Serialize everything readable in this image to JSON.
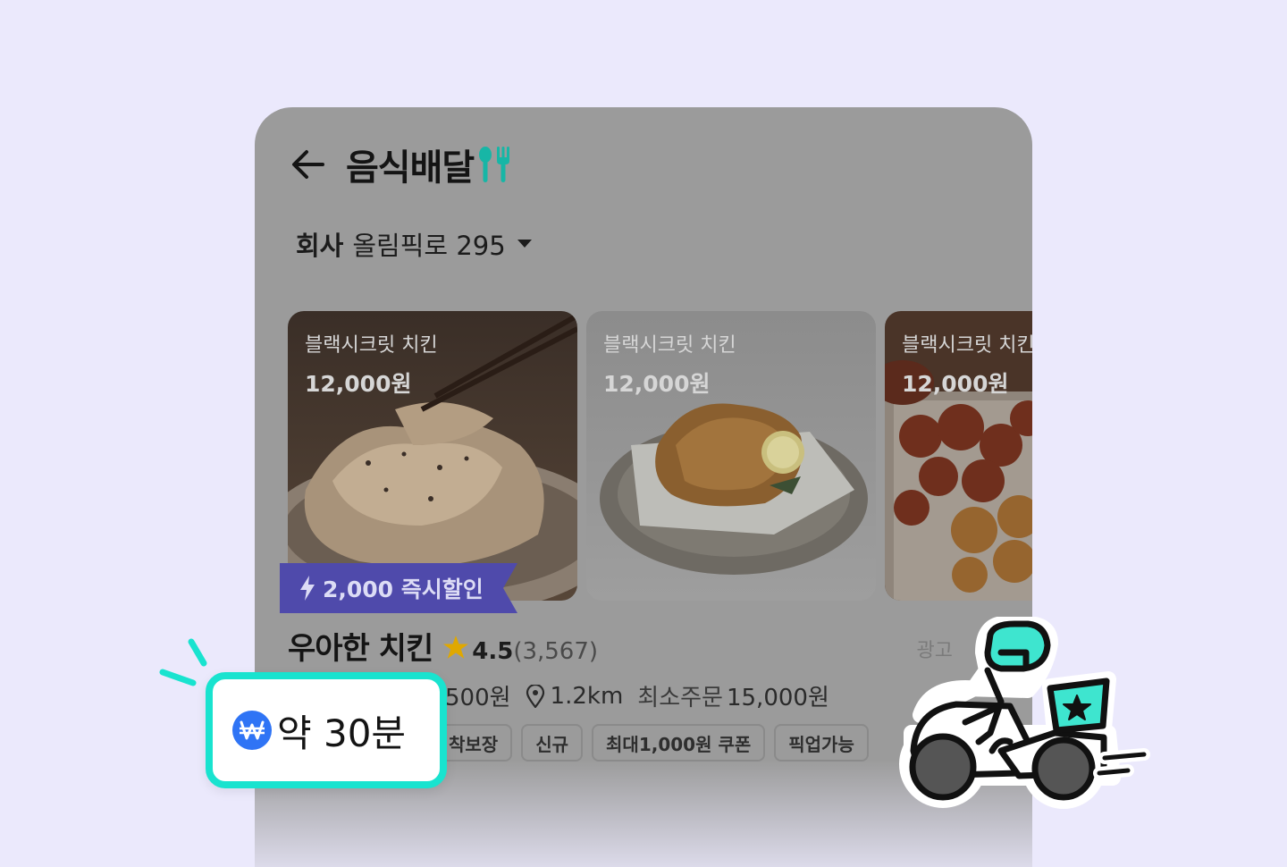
{
  "header": {
    "title": "음식배달"
  },
  "address": {
    "label": "회사",
    "value": "올림픽로 295"
  },
  "cards": [
    {
      "name": "블랙시크릿 치킨",
      "price": "12,000원"
    },
    {
      "name": "블랙시크릿 치킨",
      "price": "12,000원"
    },
    {
      "name": "블랙시크릿 치킨",
      "price": "12,000원"
    }
  ],
  "discount": {
    "label": "2,000 즉시할인"
  },
  "store": {
    "name": "우아한 치킨",
    "rating": "4.5",
    "reviews": "(3,567)",
    "ad_label": "광고"
  },
  "info": {
    "delivery_fee": "500원",
    "distance": "1.2km",
    "min_order_label": "최소주문",
    "min_order_value": "15,000원"
  },
  "tags": [
    "착보장",
    "신규",
    "최대1,000원 쿠폰",
    "픽업가능"
  ],
  "eta": {
    "text": "약 30분"
  },
  "colors": {
    "background": "#ebe9fc",
    "accent_mint": "#19e3cf",
    "discount_purple": "#4f4aab",
    "won_blue": "#2f74f5",
    "star": "#e0a800"
  },
  "icons": {
    "back": "arrow-left-icon",
    "utensils": "fork-spoon-icon",
    "caret": "caret-down-icon",
    "bolt": "lightning-icon",
    "star": "star-icon",
    "pin": "location-pin-icon",
    "won": "won-coin-icon",
    "rider": "delivery-rider-icon"
  }
}
